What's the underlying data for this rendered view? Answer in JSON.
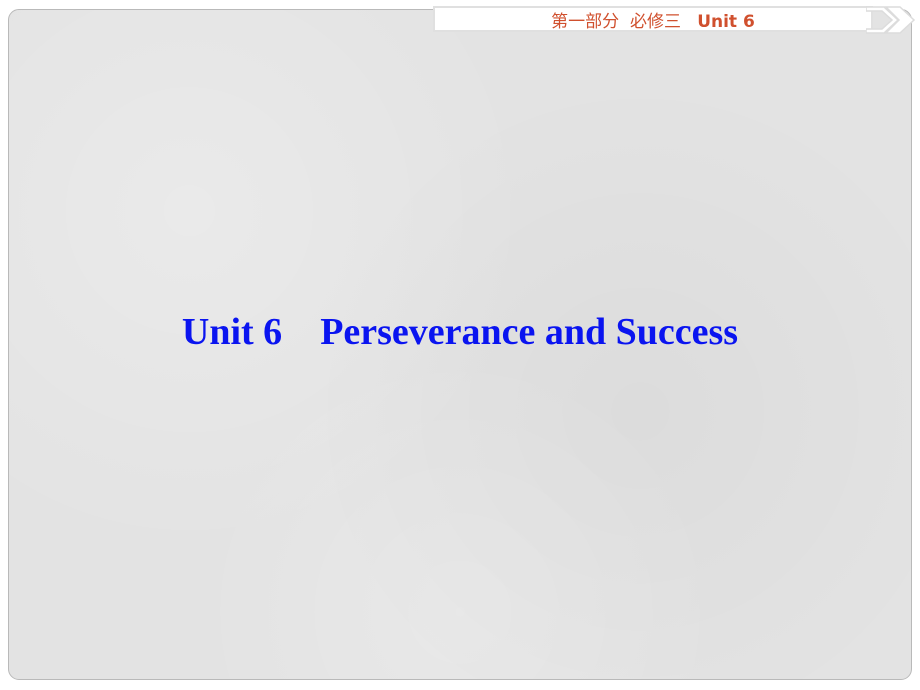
{
  "header": {
    "section_cn": "第一部分  必修三",
    "unit_label": "Unit 6",
    "text_color": "#d0502e"
  },
  "slide": {
    "title_unit": "Unit 6",
    "title_topic": "Perseverance and Success",
    "title_color": "#0a14f0",
    "background_color": "#e3e3e3"
  },
  "icons": {
    "next": "double-chevron-right-icon"
  }
}
